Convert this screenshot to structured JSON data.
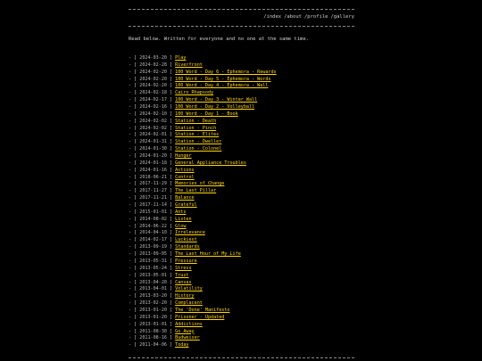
{
  "nav": [
    {
      "label": "/index"
    },
    {
      "label": "/about"
    },
    {
      "label": "/profile"
    },
    {
      "label": "/gallery"
    }
  ],
  "intro": "Read below. Written for everyone and no one at the same time.",
  "colors": {
    "background": "#000000",
    "text": "#c8c8c8",
    "link": "#ffd60a"
  },
  "posts": [
    {
      "date": "2024-03-20",
      "title": "Play"
    },
    {
      "date": "2024-02-28",
      "title": "Riverfront"
    },
    {
      "date": "2024-02-20",
      "title": "100 Word - Day 6 - Ephemora - Rewards"
    },
    {
      "date": "2024-02-20",
      "title": "100 Word - Day 5 - Ephemora - Words"
    },
    {
      "date": "2024-02-20",
      "title": "100 Word - Day 4 - Ephemora - Wall"
    },
    {
      "date": "2024-02-18",
      "title": "Cairo Rhapsody"
    },
    {
      "date": "2024-02-17",
      "title": "100 Word - Day 3 - Winter Wall"
    },
    {
      "date": "2024-02-16",
      "title": "100 Word - Day 2 - Volleyball"
    },
    {
      "date": "2024-02-10",
      "title": "100 Word - Day 1 - Book"
    },
    {
      "date": "2024-02-02",
      "title": "Station - Death"
    },
    {
      "date": "2024-02-02",
      "title": "Station - Pinch"
    },
    {
      "date": "2024-02-01",
      "title": "Station - Elites"
    },
    {
      "date": "2024-01-31",
      "title": "Station - Dweller"
    },
    {
      "date": "2024-01-30",
      "title": "Station - Colonel"
    },
    {
      "date": "2024-01-20",
      "title": "Hunger"
    },
    {
      "date": "2024-01-18",
      "title": "General Appliance Troubles"
    },
    {
      "date": "2024-01-16",
      "title": "Actions"
    },
    {
      "date": "2018-06-21",
      "title": "Control"
    },
    {
      "date": "2017-11-29",
      "title": "Memories of Change"
    },
    {
      "date": "2017-11-27",
      "title": "The Last Pillar"
    },
    {
      "date": "2017-11-21",
      "title": "Balance"
    },
    {
      "date": "2017-11-14",
      "title": "Grateful"
    },
    {
      "date": "2015-01-01",
      "title": "Ants"
    },
    {
      "date": "2014-08-02",
      "title": "Listen"
    },
    {
      "date": "2014-06-22",
      "title": "Glow"
    },
    {
      "date": "2014-04-10",
      "title": "Irrelevance"
    },
    {
      "date": "2014-02-17",
      "title": "Luckiest"
    },
    {
      "date": "2013-09-19",
      "title": "Standards"
    },
    {
      "date": "2013-09-05",
      "title": "The Last Hour of My Life"
    },
    {
      "date": "2013-05-31",
      "title": "Pressure"
    },
    {
      "date": "2013-05-24",
      "title": "Stress"
    },
    {
      "date": "2013-05-01",
      "title": "Trust"
    },
    {
      "date": "2013-04-20",
      "title": "Canvas"
    },
    {
      "date": "2013-04-01",
      "title": "Volatility"
    },
    {
      "date": "2013-03-20",
      "title": "History"
    },
    {
      "date": "2013-02-20",
      "title": "Complacent"
    },
    {
      "date": "2013-01-20",
      "title": "The 'Done' Manifesto"
    },
    {
      "date": "2013-01-20",
      "title": "Prisoner - Updated"
    },
    {
      "date": "2013-01-01",
      "title": "Addictions"
    },
    {
      "date": "2011-08-30",
      "title": "Go Away"
    },
    {
      "date": "2011-08-16",
      "title": "Budweiser"
    },
    {
      "date": "2011-04-06",
      "title": "Today"
    }
  ]
}
